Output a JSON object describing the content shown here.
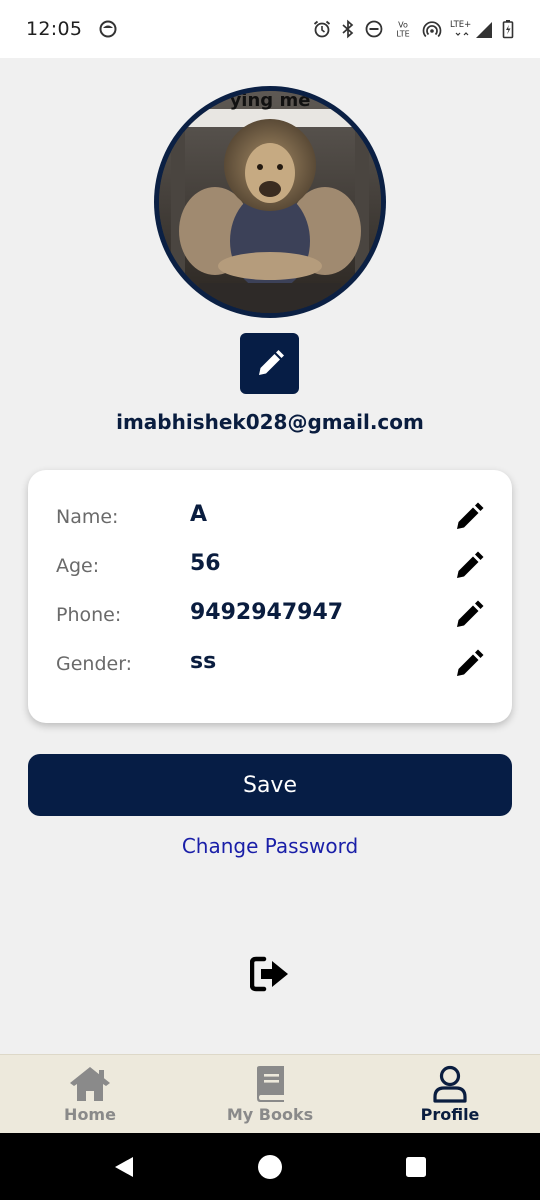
{
  "status_bar": {
    "time": "12:05",
    "icons": [
      "alarm-icon",
      "bluetooth-icon",
      "do-not-disturb-icon",
      "volte-icon",
      "hotspot-icon",
      "lte-signal-icon",
      "battery-icon"
    ],
    "volte_label_top": "Vo",
    "volte_label_bottom": "LTE",
    "lte_label": "LTE+"
  },
  "profile": {
    "avatar_banner_text": "ying me",
    "email": "imabhishek028@gmail.com"
  },
  "fields": [
    {
      "label": "Name:",
      "value": "A"
    },
    {
      "label": "Age:",
      "value": "56"
    },
    {
      "label": "Phone:",
      "value": "9492947947"
    },
    {
      "label": "Gender:",
      "value": "ss"
    }
  ],
  "actions": {
    "save_label": "Save",
    "change_password_label": "Change Password"
  },
  "bottom_nav": {
    "items": [
      {
        "label": "Home",
        "icon": "home-icon",
        "active": false
      },
      {
        "label": "My Books",
        "icon": "book-icon",
        "active": false
      },
      {
        "label": "Profile",
        "icon": "user-icon",
        "active": true
      }
    ]
  },
  "colors": {
    "primary": "#061d45",
    "link": "#1a1fa8",
    "nav_bg": "#ede9dc",
    "page_bg": "#f0f0f0"
  }
}
